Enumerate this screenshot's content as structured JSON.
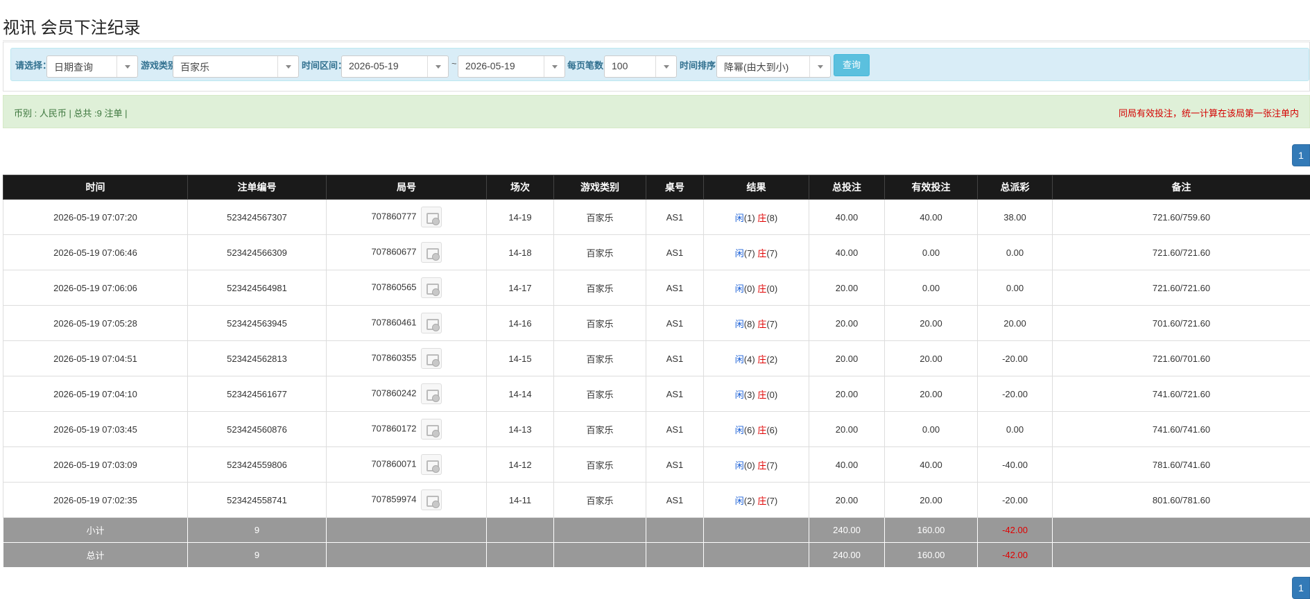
{
  "page_title": "视讯 会员下注纪录",
  "filters": {
    "select_label": "请选择：",
    "select_value": "日期查询",
    "game_type_label": "游戏类别",
    "game_type_value": "百家乐",
    "time_range_label": "时间区间：",
    "date_from": "2026-05-19",
    "tilde": "~",
    "date_to": "2026-05-19",
    "per_page_label": "每页笔数：",
    "per_page_value": "100",
    "sort_label": "时间排序：",
    "sort_value": "降幂(由大到小)",
    "query_button": "查询"
  },
  "summary": {
    "left": "币别 : 人民币 | 总共 :9 注单 |",
    "right": "同局有效投注，统一计算在该局第一张注单内"
  },
  "pagination": {
    "page": "1"
  },
  "table": {
    "headers": [
      "时间",
      "注单编号",
      "局号",
      "场次",
      "游戏类别",
      "桌号",
      "结果",
      "总投注",
      "有效投注",
      "总派彩",
      "备注"
    ],
    "player_label": "闲",
    "banker_label": "庄",
    "rows": [
      {
        "time": "2026-05-19 07:07:20",
        "bet_id": "523424567307",
        "round": "707860777",
        "session": "14-19",
        "game": "百家乐",
        "table": "AS1",
        "player": "(1)",
        "banker": "(8)",
        "total_bet": "40.00",
        "valid_bet": "40.00",
        "payout": "38.00",
        "payout_negative": false,
        "note": "721.60/759.60"
      },
      {
        "time": "2026-05-19 07:06:46",
        "bet_id": "523424566309",
        "round": "707860677",
        "session": "14-18",
        "game": "百家乐",
        "table": "AS1",
        "player": "(7)",
        "banker": "(7)",
        "total_bet": "40.00",
        "valid_bet": "0.00",
        "payout": "0.00",
        "payout_negative": false,
        "note": "721.60/721.60"
      },
      {
        "time": "2026-05-19 07:06:06",
        "bet_id": "523424564981",
        "round": "707860565",
        "session": "14-17",
        "game": "百家乐",
        "table": "AS1",
        "player": "(0)",
        "banker": "(0)",
        "total_bet": "20.00",
        "valid_bet": "0.00",
        "payout": "0.00",
        "payout_negative": false,
        "note": "721.60/721.60"
      },
      {
        "time": "2026-05-19 07:05:28",
        "bet_id": "523424563945",
        "round": "707860461",
        "session": "14-16",
        "game": "百家乐",
        "table": "AS1",
        "player": "(8)",
        "banker": "(7)",
        "total_bet": "20.00",
        "valid_bet": "20.00",
        "payout": "20.00",
        "payout_negative": false,
        "note": "701.60/721.60"
      },
      {
        "time": "2026-05-19 07:04:51",
        "bet_id": "523424562813",
        "round": "707860355",
        "session": "14-15",
        "game": "百家乐",
        "table": "AS1",
        "player": "(4)",
        "banker": "(2)",
        "total_bet": "20.00",
        "valid_bet": "20.00",
        "payout": "-20.00",
        "payout_negative": true,
        "note": "721.60/701.60"
      },
      {
        "time": "2026-05-19 07:04:10",
        "bet_id": "523424561677",
        "round": "707860242",
        "session": "14-14",
        "game": "百家乐",
        "table": "AS1",
        "player": "(3)",
        "banker": "(0)",
        "total_bet": "20.00",
        "valid_bet": "20.00",
        "payout": "-20.00",
        "payout_negative": true,
        "note": "741.60/721.60"
      },
      {
        "time": "2026-05-19 07:03:45",
        "bet_id": "523424560876",
        "round": "707860172",
        "session": "14-13",
        "game": "百家乐",
        "table": "AS1",
        "player": "(6)",
        "banker": "(6)",
        "total_bet": "20.00",
        "valid_bet": "0.00",
        "payout": "0.00",
        "payout_negative": false,
        "note": "741.60/741.60"
      },
      {
        "time": "2026-05-19 07:03:09",
        "bet_id": "523424559806",
        "round": "707860071",
        "session": "14-12",
        "game": "百家乐",
        "table": "AS1",
        "player": "(0)",
        "banker": "(7)",
        "total_bet": "40.00",
        "valid_bet": "40.00",
        "payout": "-40.00",
        "payout_negative": true,
        "note": "781.60/741.60"
      },
      {
        "time": "2026-05-19 07:02:35",
        "bet_id": "523424558741",
        "round": "707859974",
        "session": "14-11",
        "game": "百家乐",
        "table": "AS1",
        "player": "(2)",
        "banker": "(7)",
        "total_bet": "20.00",
        "valid_bet": "20.00",
        "payout": "-20.00",
        "payout_negative": true,
        "note": "801.60/781.60"
      }
    ],
    "subtotal": {
      "label": "小计",
      "count": "9",
      "total_bet": "240.00",
      "valid_bet": "160.00",
      "payout": "-42.00"
    },
    "grand_total": {
      "label": "总计",
      "count": "9",
      "total_bet": "240.00",
      "valid_bet": "160.00",
      "payout": "-42.00"
    }
  },
  "colors": {
    "header_bg": "#1a1a1a",
    "footer_bg": "#999999",
    "filter_bg": "#d9edf7",
    "summary_bg": "#dff0d8",
    "link_blue": "#1a5fd6",
    "negative_red": "#e00000",
    "page_btn": "#337ab7"
  }
}
